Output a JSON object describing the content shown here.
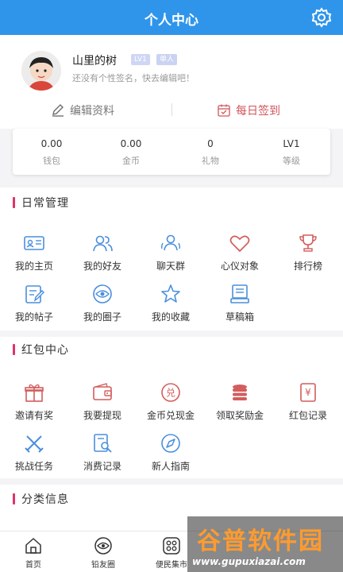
{
  "header": {
    "title": "个人中心",
    "settings_icon": "gear-icon"
  },
  "profile": {
    "username": "山里的树",
    "level_badge": "LV1",
    "gender_badge": "单人",
    "signature": "还没有个性签名，快去编辑吧！",
    "edit_label": "编辑资料",
    "checkin_label": "每日签到"
  },
  "stats": [
    {
      "value": "0.00",
      "label": "钱包"
    },
    {
      "value": "0.00",
      "label": "金币"
    },
    {
      "value": "0",
      "label": "礼物"
    },
    {
      "value": "LV1",
      "label": "等级"
    }
  ],
  "sections": {
    "daily": {
      "title": "日常管理",
      "items": [
        {
          "label": "我的主页",
          "icon": "id-card-icon"
        },
        {
          "label": "我的好友",
          "icon": "friends-icon"
        },
        {
          "label": "聊天群",
          "icon": "group-chat-icon"
        },
        {
          "label": "心仪对象",
          "icon": "heart-icon"
        },
        {
          "label": "排行榜",
          "icon": "trophy-icon"
        },
        {
          "label": "我的帖子",
          "icon": "edit-note-icon"
        },
        {
          "label": "我的圈子",
          "icon": "circle-eye-icon"
        },
        {
          "label": "我的收藏",
          "icon": "star-icon"
        },
        {
          "label": "草稿箱",
          "icon": "drafts-icon"
        }
      ]
    },
    "redpacket": {
      "title": "红包中心",
      "items": [
        {
          "label": "邀请有奖",
          "icon": "gift-icon"
        },
        {
          "label": "我要提现",
          "icon": "wallet-icon"
        },
        {
          "label": "金币兑现金",
          "icon": "exchange-icon",
          "glyph": "兑"
        },
        {
          "label": "领取奖励金",
          "icon": "coins-icon"
        },
        {
          "label": "红包记录",
          "icon": "receipt-icon",
          "glyph": "¥"
        },
        {
          "label": "挑战任务",
          "icon": "swords-icon"
        },
        {
          "label": "消费记录",
          "icon": "search-record-icon"
        },
        {
          "label": "新人指南",
          "icon": "compass-icon"
        }
      ]
    },
    "category": {
      "title": "分类信息"
    }
  },
  "tabs": [
    {
      "label": "首页",
      "icon": "home-icon"
    },
    {
      "label": "铅友圈",
      "icon": "circle-icon"
    },
    {
      "label": "便民集市",
      "icon": "market-icon"
    }
  ],
  "watermark": {
    "brand": "谷普软件园",
    "url": "www.gupuxiazai.com"
  },
  "colors": {
    "primary": "#2f95ea",
    "icon_blue": "#4a8fdc",
    "icon_red": "#d35d5d",
    "accent": "#e0336a"
  }
}
